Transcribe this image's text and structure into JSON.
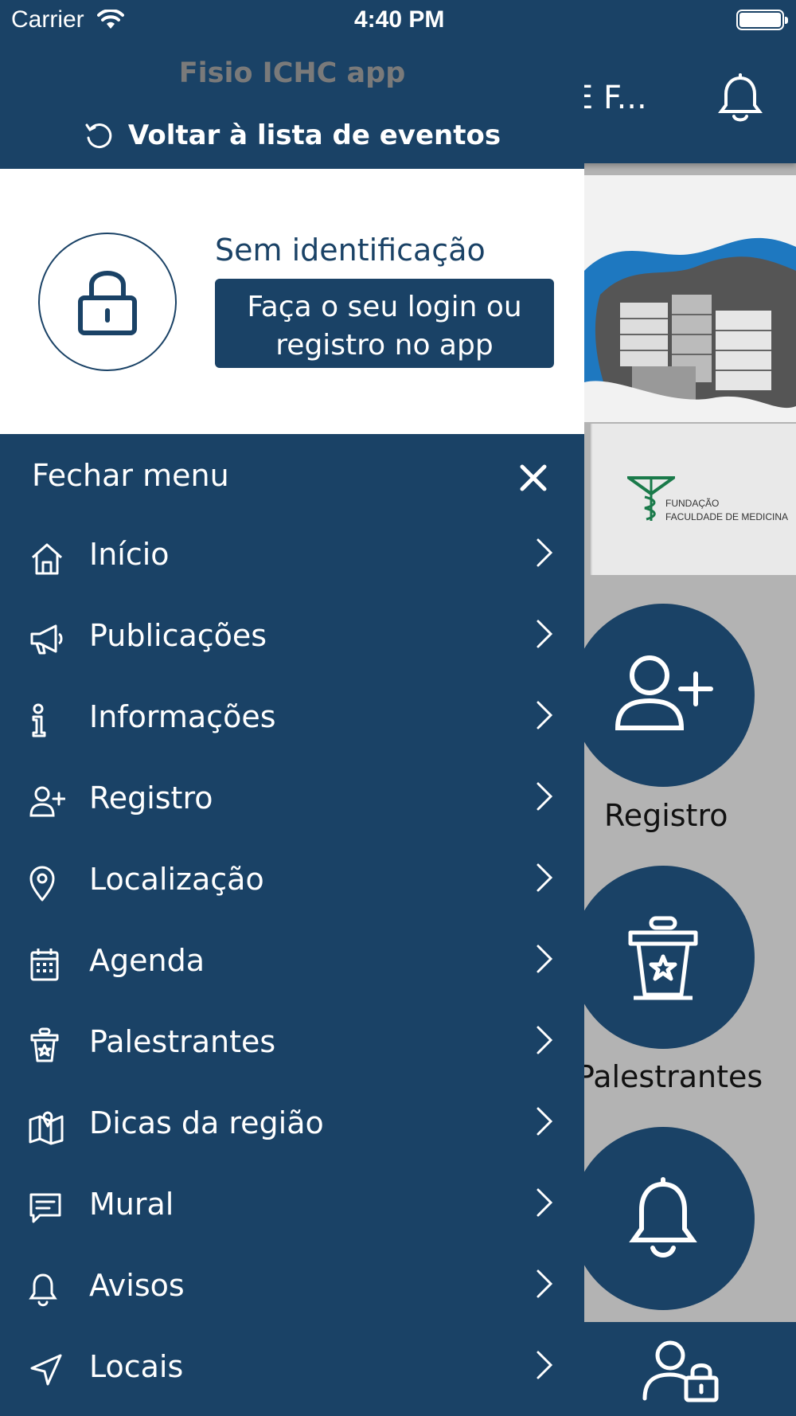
{
  "status_bar": {
    "carrier": "Carrier",
    "time": "4:40 PM"
  },
  "background": {
    "header_title": "E F...",
    "logo_text_line1": "FUNDAÇÃO",
    "logo_text_line2": "FACULDADE DE MEDICINA",
    "tiles": [
      "Registro",
      "Palestrantes"
    ]
  },
  "drawer": {
    "app_name": "Fisio ICHC app",
    "back_label": "Voltar à lista de eventos",
    "profile": {
      "status": "Sem identificação",
      "login_line1": "Faça o seu login ou",
      "login_line2": "registro no app"
    },
    "close_label": "Fechar menu",
    "items": [
      {
        "label": "Início",
        "icon": "home-icon"
      },
      {
        "label": "Publicações",
        "icon": "megaphone-icon"
      },
      {
        "label": "Informações",
        "icon": "info-icon"
      },
      {
        "label": "Registro",
        "icon": "user-plus-icon"
      },
      {
        "label": "Localização",
        "icon": "map-pin-icon"
      },
      {
        "label": "Agenda",
        "icon": "calendar-icon"
      },
      {
        "label": "Palestrantes",
        "icon": "podium-icon"
      },
      {
        "label": "Dicas da região",
        "icon": "map-icon"
      },
      {
        "label": "Mural",
        "icon": "chat-icon"
      },
      {
        "label": "Avisos",
        "icon": "bell-icon"
      },
      {
        "label": "Locais",
        "icon": "navigation-icon"
      }
    ]
  },
  "colors": {
    "navy": "#1a4266",
    "app_name_gray": "#7a7a7a",
    "background_gray": "#b3b3b3"
  }
}
